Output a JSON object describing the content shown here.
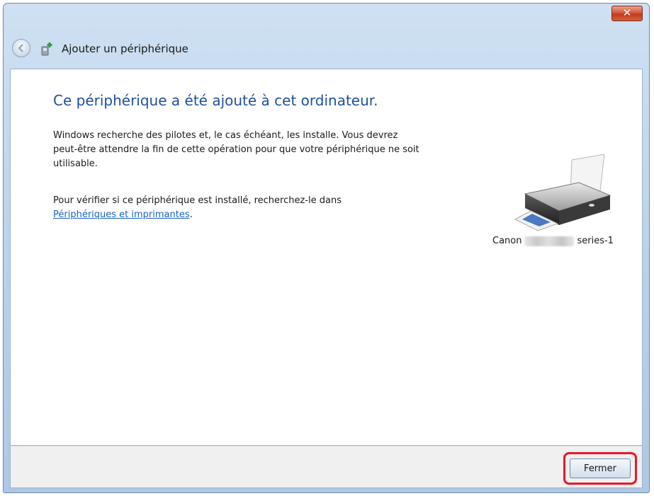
{
  "window": {
    "close_symbol": "✕",
    "wizard_title": "Ajouter un périphérique"
  },
  "content": {
    "main_title": "Ce périphérique a été ajouté à cet ordinateur.",
    "paragraph1": "Windows recherche des pilotes et, le cas échéant, les installe. Vous devrez peut-être attendre la fin de cette opération pour que votre périphérique ne soit utilisable.",
    "paragraph2_text": "Pour vérifier si ce périphérique est installé, recherchez-le dans",
    "paragraph2_link": "Périphériques et imprimantes",
    "paragraph2_end": ".",
    "device": {
      "prefix": "Canon",
      "suffix": "series-1",
      "icon": "printer-icon"
    }
  },
  "footer": {
    "close_label": "Fermer"
  },
  "colors": {
    "title_blue": "#1e50a0",
    "link_blue": "#1a64c8",
    "highlight_red": "#e8172b"
  }
}
